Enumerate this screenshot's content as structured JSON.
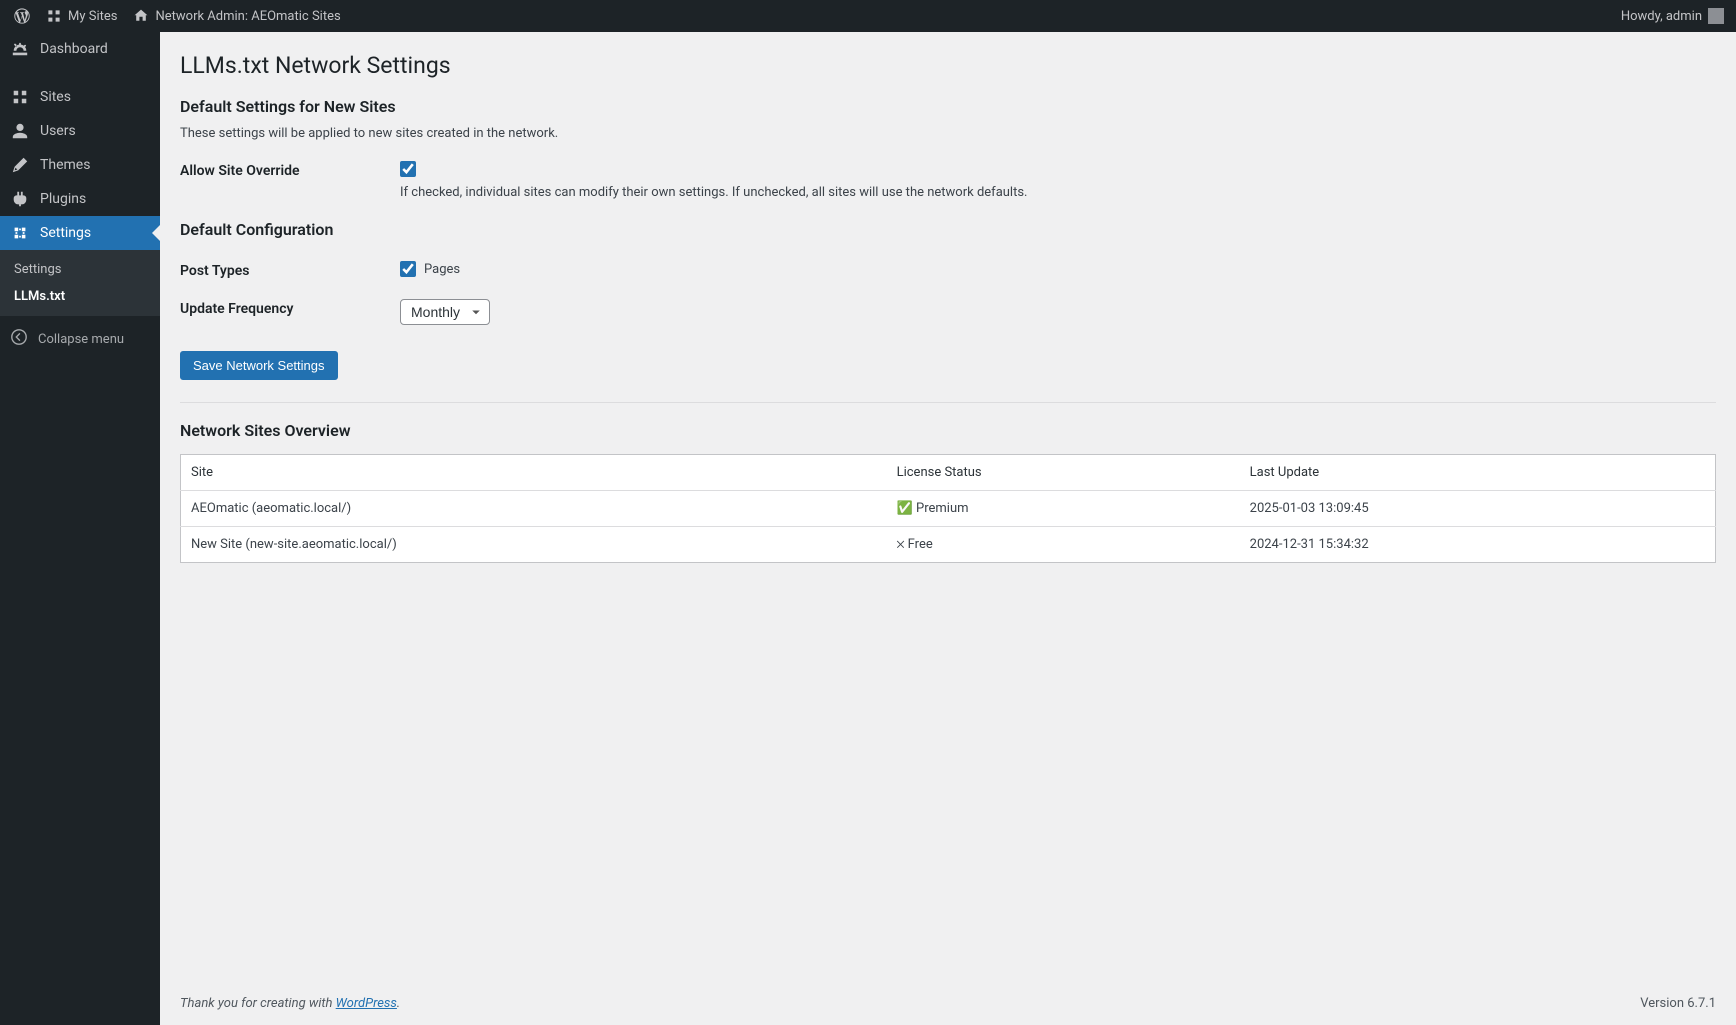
{
  "admin_bar": {
    "my_sites": "My Sites",
    "network_admin": "Network Admin: AEOmatic Sites",
    "howdy": "Howdy, admin"
  },
  "sidebar": {
    "items": [
      {
        "label": "Dashboard"
      },
      {
        "label": "Sites"
      },
      {
        "label": "Users"
      },
      {
        "label": "Themes"
      },
      {
        "label": "Plugins"
      },
      {
        "label": "Settings"
      }
    ],
    "submenu": {
      "settings": "Settings",
      "llms": "LLMs.txt"
    },
    "collapse": "Collapse menu"
  },
  "page": {
    "title": "LLMs.txt Network Settings",
    "section_defaults_title": "Default Settings for New Sites",
    "section_defaults_desc": "These settings will be applied to new sites created in the network.",
    "allow_override_label": "Allow Site Override",
    "allow_override_desc": "If checked, individual sites can modify their own settings. If unchecked, all sites will use the network defaults.",
    "default_config_title": "Default Configuration",
    "post_types_label": "Post Types",
    "post_types_option_pages": "Pages",
    "update_frequency_label": "Update Frequency",
    "update_frequency_value": "Monthly",
    "save_button": "Save Network Settings",
    "overview_title": "Network Sites Overview",
    "table": {
      "headers": {
        "site": "Site",
        "license": "License Status",
        "last_update": "Last Update"
      },
      "rows": [
        {
          "site": "AEOmatic (aeomatic.local/)",
          "status_icon": "✅",
          "status_label": "Premium",
          "last_update": "2025-01-03 13:09:45"
        },
        {
          "site": "New Site (new-site.aeomatic.local/)",
          "status_icon": "❌",
          "status_label": "Free",
          "last_update": "2024-12-31 15:34:32"
        }
      ]
    }
  },
  "footer": {
    "thanks_pre": "Thank you for creating with ",
    "wp": "WordPress",
    "thanks_post": ".",
    "version": "Version 6.7.1"
  }
}
